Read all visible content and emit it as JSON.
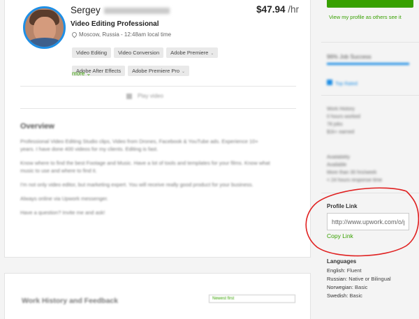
{
  "profile": {
    "first_name": "Sergey",
    "rate_value": "$47.94",
    "rate_unit": "/hr",
    "title": "Video Editing Professional",
    "location": "Moscow, Russia - 12:48am local time",
    "skills": [
      "Video Editing",
      "Video Conversion",
      "Adobe Premiere",
      "Adobe After Effects",
      "Adobe Premiere Pro"
    ],
    "more_label": "more",
    "video_label": "Play video"
  },
  "overview": {
    "heading": "Overview",
    "paragraphs": [
      "Professional Video Editing Studio clips, Video from Drones, Facebook & YouTube ads. Experience 10+ years. I have done 400 videos for my clients. Editing is fast.",
      "Know where to find the best Footage and Music. Have a lot of tools and templates for your films. Know what music to use and where to find it.",
      "I'm not only video editor, but marketing expert. You will receive really good product for your business.",
      "Always online via Upwork messenger.",
      "Have a question? Invite me and ask!"
    ]
  },
  "work_history": {
    "title": "Work History and Feedback",
    "filter_value": "Newest first"
  },
  "sidebar": {
    "view_profile_link": "View my profile as others see it",
    "job_success": "96% Job Success",
    "badge": "Top Rated",
    "work_history_heading": "Work History",
    "hours_worked": "0 hours worked",
    "jobs": "78 jobs",
    "earned": "$1k+ earned",
    "availability_heading": "Availability",
    "availability_status": "Available",
    "availability_detail": "More than 30 hrs/week",
    "response_time": "< 24 hours response time",
    "profile_link_label": "Profile Link",
    "profile_link_value": "http://www.upwork.com/o/profiles/users/",
    "copy_link": "Copy Link",
    "languages_heading": "Languages",
    "languages": [
      {
        "name": "English:",
        "level": "Fluent"
      },
      {
        "name": "Russian:",
        "level": "Native or Bilingual"
      },
      {
        "name": "Norwegian:",
        "level": "Basic"
      },
      {
        "name": "Swedish:",
        "level": "Basic"
      }
    ]
  },
  "colors": {
    "brand_green": "#37a000",
    "avatar_ring": "#1f8fe5",
    "annotation_red": "#e02020"
  }
}
